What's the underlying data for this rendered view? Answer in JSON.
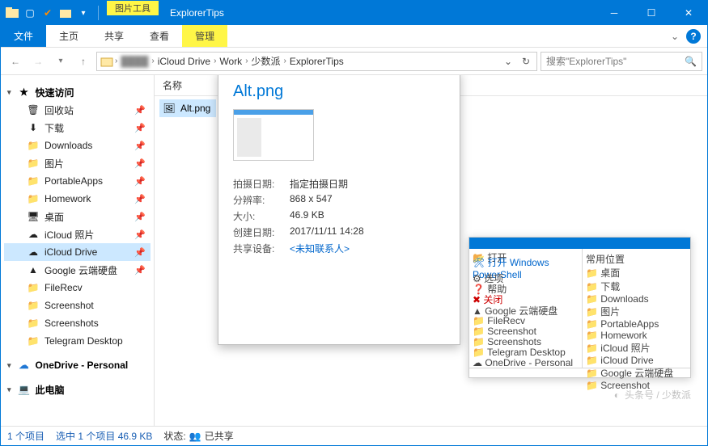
{
  "titlebar": {
    "tool_label": "图片工具",
    "title": "ExplorerTips"
  },
  "ribbon": {
    "file": "文件",
    "home": "主页",
    "share": "共享",
    "view": "查看",
    "manage": "管理"
  },
  "breadcrumb": [
    "iCloud Drive",
    "Work",
    "少数派",
    "ExplorerTips"
  ],
  "search": {
    "placeholder": "搜索\"ExplorerTips\""
  },
  "sidebar": {
    "quick": "快速访问",
    "items": [
      "回收站",
      "下载",
      "Downloads",
      "图片",
      "PortableApps",
      "Homework",
      "桌面",
      "iCloud 照片",
      "iCloud Drive",
      "Google 云端硬盘",
      "FileRecv",
      "Screenshot",
      "Screenshots",
      "Telegram Desktop"
    ],
    "onedrive": "OneDrive - Personal",
    "thispc": "此电脑"
  },
  "content": {
    "column": "名称",
    "file": "Alt.png"
  },
  "preview": {
    "title": "Alt.png",
    "meta": [
      {
        "k": "拍摄日期:",
        "v": "指定拍摄日期"
      },
      {
        "k": "分辨率:",
        "v": "868 x 547"
      },
      {
        "k": "大小:",
        "v": "46.9 KB"
      },
      {
        "k": "创建日期:",
        "v": "2017/11/11 14:28"
      },
      {
        "k": "共享设备:",
        "v": "<未知联系人>"
      }
    ]
  },
  "status": {
    "items": "1 个项目",
    "selected": "选中 1 个项目  46.9 KB",
    "state_label": "状态:",
    "shared": "已共享"
  },
  "watermark": "头条号 / 少数派"
}
